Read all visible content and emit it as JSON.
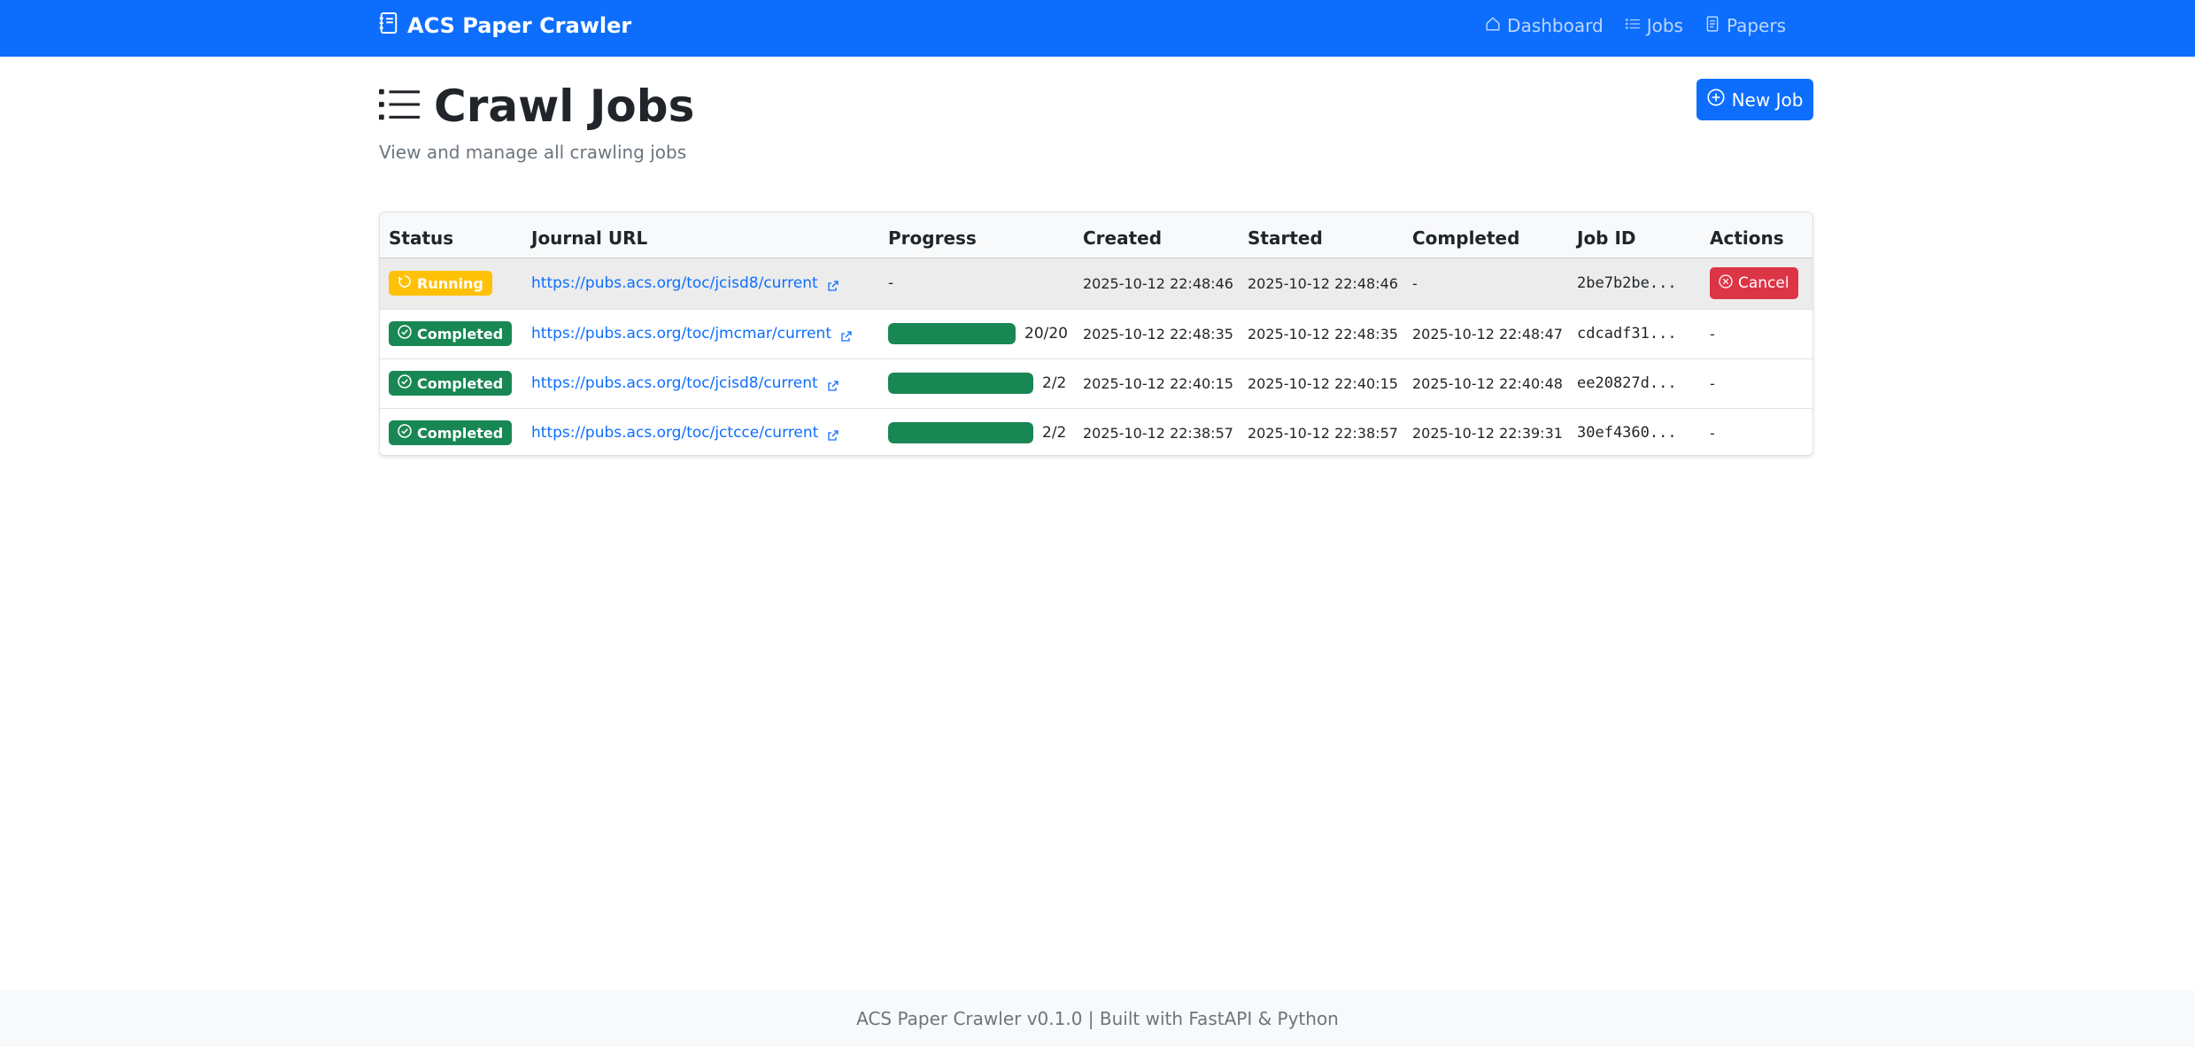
{
  "app": {
    "brand": "ACS Paper Crawler",
    "nav": [
      {
        "label": "Dashboard",
        "icon": "house-icon"
      },
      {
        "label": "Jobs",
        "icon": "list-icon"
      },
      {
        "label": "Papers",
        "icon": "file-text-icon"
      }
    ]
  },
  "header": {
    "title": "Crawl Jobs",
    "subtitle": "View and manage all crawling jobs",
    "new_job_label": "New Job"
  },
  "table": {
    "columns": [
      "Status",
      "Journal URL",
      "Progress",
      "Created",
      "Started",
      "Completed",
      "Job ID",
      "Actions"
    ],
    "rows": [
      {
        "status": "Running",
        "url": "https://pubs.acs.org/toc/jcisd8/current",
        "progress": null,
        "progress_text": "-",
        "created": "2025-10-12 22:48:46",
        "started": "2025-10-12 22:48:46",
        "completed": "-",
        "job_id": "2be7b2be...",
        "action": "Cancel"
      },
      {
        "status": "Completed",
        "url": "https://pubs.acs.org/toc/jmcmar/current",
        "progress": 1.0,
        "progress_text": "20/20",
        "created": "2025-10-12 22:48:35",
        "started": "2025-10-12 22:48:35",
        "completed": "2025-10-12 22:48:47",
        "job_id": "cdcadf31...",
        "action": "-"
      },
      {
        "status": "Completed",
        "url": "https://pubs.acs.org/toc/jcisd8/current",
        "progress": 1.0,
        "progress_text": "2/2",
        "created": "2025-10-12 22:40:15",
        "started": "2025-10-12 22:40:15",
        "completed": "2025-10-12 22:40:48",
        "job_id": "ee20827d...",
        "action": "-"
      },
      {
        "status": "Completed",
        "url": "https://pubs.acs.org/toc/jctcce/current",
        "progress": 1.0,
        "progress_text": "2/2",
        "created": "2025-10-12 22:38:57",
        "started": "2025-10-12 22:38:57",
        "completed": "2025-10-12 22:39:31",
        "job_id": "30ef4360...",
        "action": "-"
      }
    ]
  },
  "footer": {
    "text": "ACS Paper Crawler v0.1.0 | Built with FastAPI & Python"
  },
  "colors": {
    "primary": "#0d6efd",
    "success": "#198754",
    "warning": "#ffc107",
    "danger": "#dc3545"
  }
}
